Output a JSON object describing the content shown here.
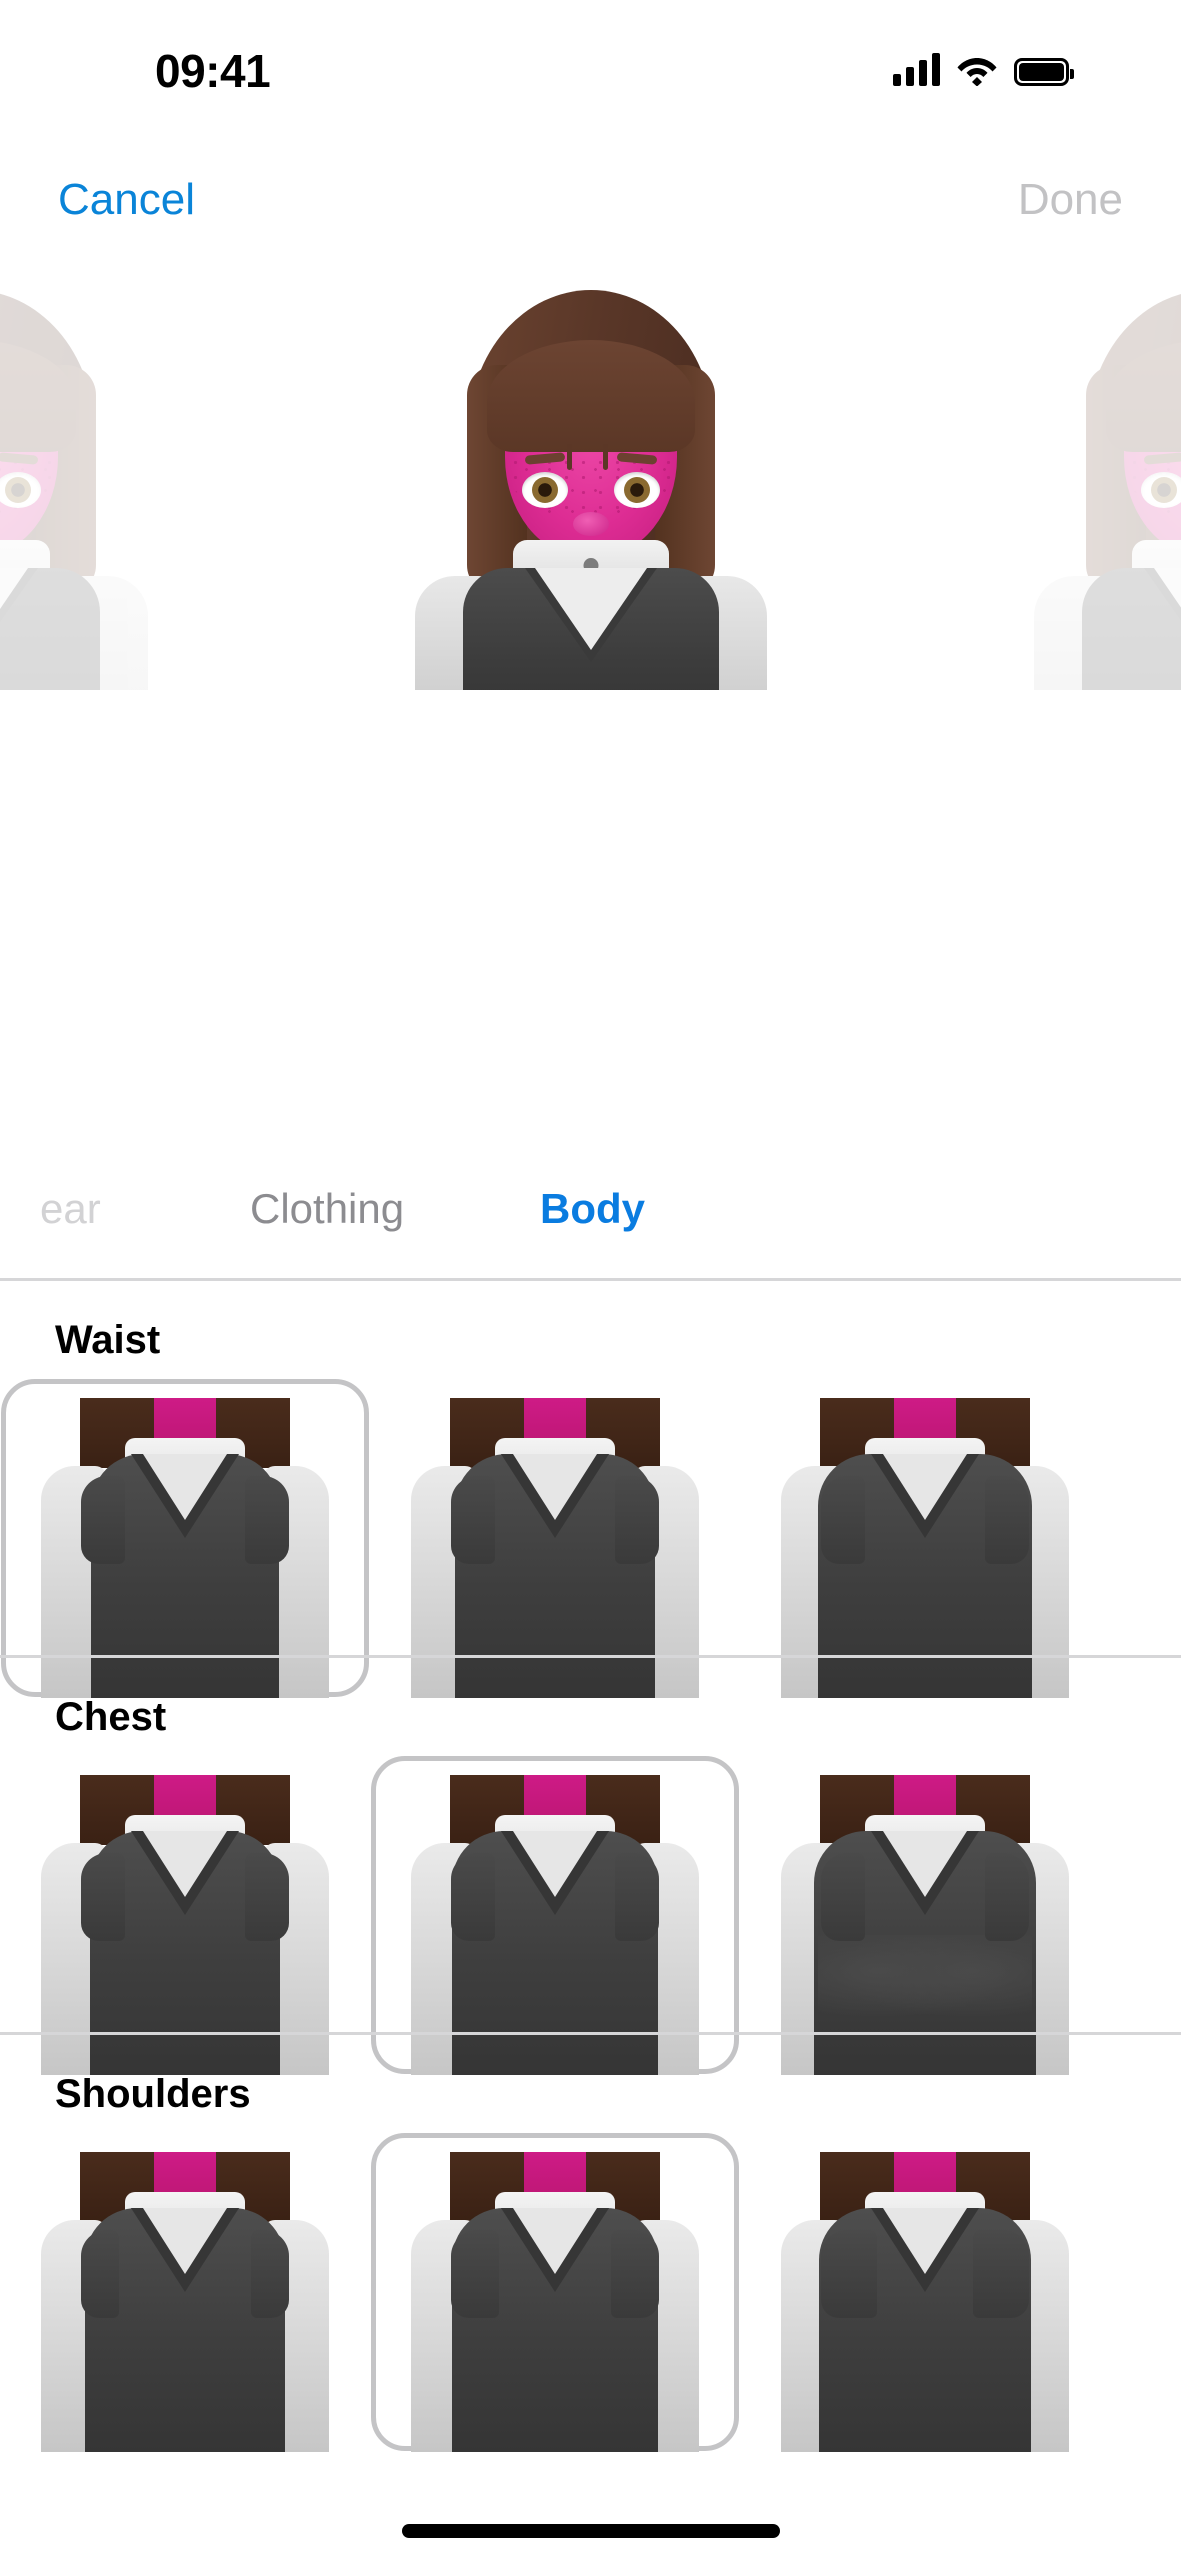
{
  "status_bar": {
    "time": "09:41",
    "cellular_icon": "cellular-signal-icon",
    "wifi_icon": "wifi-icon",
    "battery_icon": "battery-icon"
  },
  "nav": {
    "cancel_label": "Cancel",
    "done_label": "Done",
    "cancel_color": "#0A84D8",
    "done_color": "#C2C2C4"
  },
  "avatar": {
    "skin_color": "#DD2C93",
    "hair_color": "#5A3728",
    "eye_color": "#8A6A30",
    "vest_color": "#3C3C3C",
    "shirt_color": "#EDEDED",
    "arm_color": "#D8D8D8",
    "preview_count": 3,
    "center_index": 1
  },
  "tabs": [
    {
      "label": "ear",
      "active": false,
      "truncated": true
    },
    {
      "label": "Clothing",
      "active": false,
      "truncated": false
    },
    {
      "label": "Body",
      "active": true,
      "truncated": false
    }
  ],
  "tab_active_color": "#0A7CE0",
  "sections": [
    {
      "title": "Waist",
      "selected_index": 0,
      "options": [
        {
          "name": "waist-option-1"
        },
        {
          "name": "waist-option-2"
        },
        {
          "name": "waist-option-3"
        }
      ]
    },
    {
      "title": "Chest",
      "selected_index": 1,
      "options": [
        {
          "name": "chest-option-1"
        },
        {
          "name": "chest-option-2"
        },
        {
          "name": "chest-option-3"
        }
      ]
    },
    {
      "title": "Shoulders",
      "selected_index": 1,
      "options": [
        {
          "name": "shoulders-option-1"
        },
        {
          "name": "shoulders-option-2"
        },
        {
          "name": "shoulders-option-3"
        }
      ]
    }
  ],
  "selection_ring_color": "#C4C4C6",
  "divider_color": "#D6D6D8",
  "home_indicator": "home-indicator"
}
